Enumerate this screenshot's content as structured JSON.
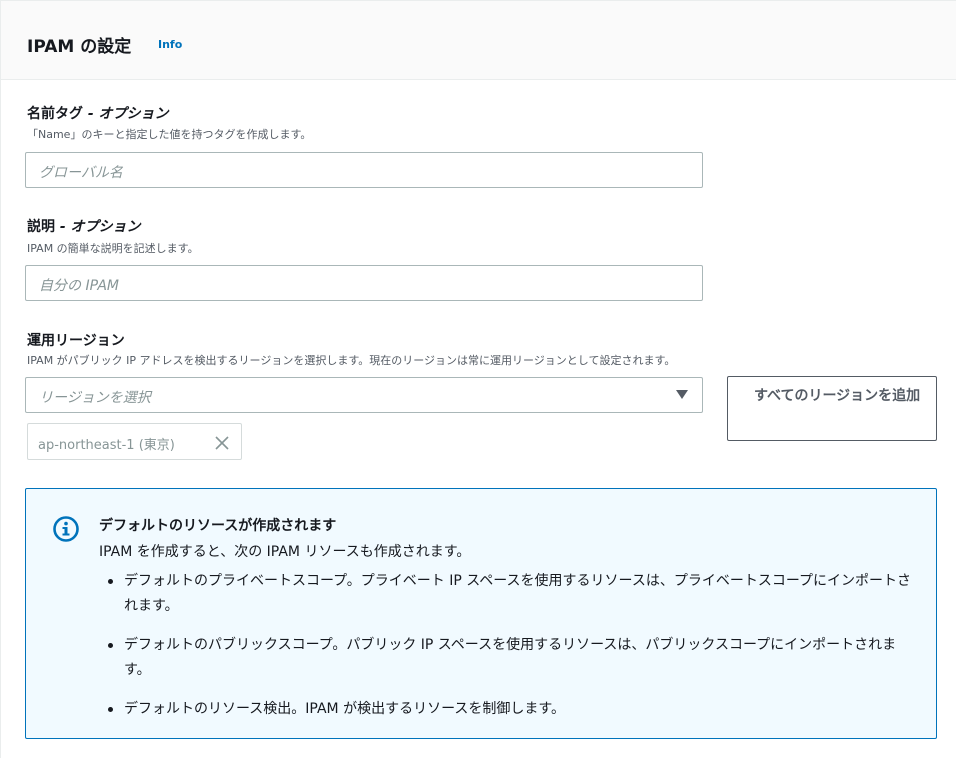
{
  "header": {
    "title": "IPAM の設定",
    "info_link": "Info"
  },
  "name_tag": {
    "label": "名前タグ",
    "optional": "- オプション",
    "description": "「Name」のキーと指定した値を持つタグを作成します。",
    "placeholder": "グローバル名"
  },
  "description_field": {
    "label": "説明",
    "optional": "- オプション",
    "description": "IPAM の簡単な説明を記述します。",
    "placeholder": "自分の IPAM"
  },
  "operating_regions": {
    "label": "運用リージョン",
    "description": "IPAM がパブリック IP アドレスを検出するリージョンを選択します。現在のリージョンは常に運用リージョンとして設定されます。",
    "select_placeholder": "リージョンを選択",
    "add_all_button": "すべてのリージョンを追加",
    "selected_token": "ap-northeast-1 (東京)"
  },
  "alert": {
    "title": "デフォルトのリソースが作成されます",
    "body": "IPAM を作成すると、次の IPAM リソースも作成されます。",
    "items": [
      "デフォルトのプライベートスコープ。プライベート IP スペースを使用するリソースは、プライベートスコープにインポートされます。",
      "デフォルトのパブリックスコープ。パブリック IP スペースを使用するリソースは、パブリックスコープにインポートされます。",
      "デフォルトのリソース検出。IPAM が検出するリソースを制御します。"
    ]
  },
  "colors": {
    "link": "#0073bb",
    "alert_bg": "#f1faff",
    "alert_border": "#0073bb"
  }
}
